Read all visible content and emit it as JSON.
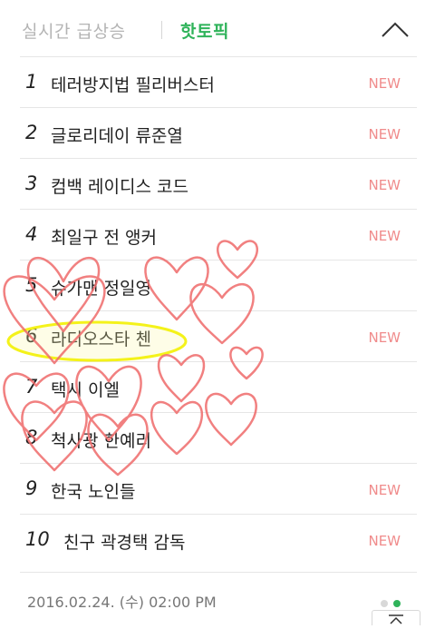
{
  "tabs": {
    "realtime_label": "실시간 급상승",
    "hot_label": "핫토픽"
  },
  "colors": {
    "active_tab": "#2fb35a",
    "new_badge": "#f08b8b",
    "highlight": "#f4f21a",
    "doodle": "#ef6b6b",
    "dot_inactive": "#d8d8d8",
    "dot_active": "#2fb35a"
  },
  "icons": {
    "collapse": "chevron-up-icon",
    "to_top": "to-top-icon"
  },
  "items": [
    {
      "rank": "1",
      "keyword": "테러방지법 필리버스터",
      "badge": "NEW"
    },
    {
      "rank": "2",
      "keyword": "글로리데이 류준열",
      "badge": "NEW"
    },
    {
      "rank": "3",
      "keyword": "컴백 레이디스 코드",
      "badge": "NEW"
    },
    {
      "rank": "4",
      "keyword": "최일구 전 앵커",
      "badge": "NEW"
    },
    {
      "rank": "5",
      "keyword": "슈가맨 정일영",
      "badge": ""
    },
    {
      "rank": "6",
      "keyword": "라디오스타 첸",
      "badge": "NEW"
    },
    {
      "rank": "7",
      "keyword": "택시 이엘",
      "badge": ""
    },
    {
      "rank": "8",
      "keyword": "척사광 한예리",
      "badge": ""
    },
    {
      "rank": "9",
      "keyword": "한국 노인들",
      "badge": "NEW"
    },
    {
      "rank": "10",
      "keyword": "친구 곽경택 감독",
      "badge": "NEW"
    }
  ],
  "footer": {
    "timestamp": "2016.02.24. (수) 02:00 PM",
    "page_count": 2,
    "active_page": 2
  }
}
